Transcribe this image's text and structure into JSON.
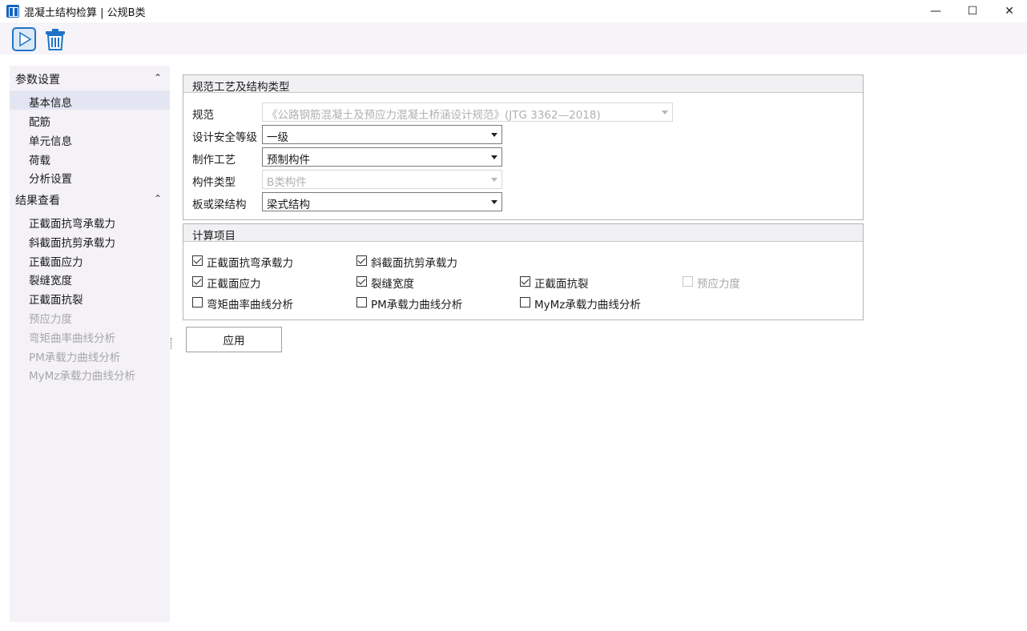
{
  "window": {
    "title": "混凝土结构检算 | 公规B类",
    "minimize": "—",
    "maximize": "☐",
    "close": "✕"
  },
  "toolbar": {
    "run_icon": "play-icon",
    "delete_icon": "trash-icon"
  },
  "sidebar": {
    "sections": [
      {
        "title": "参数设置",
        "items": [
          "基本信息",
          "配筋",
          "单元信息",
          "荷载",
          "分析设置"
        ]
      },
      {
        "title": "结果查看",
        "items": [
          "正截面抗弯承载力",
          "斜截面抗剪承载力",
          "正截面应力",
          "裂缝宽度",
          "正截面抗裂",
          "预应力度",
          "弯矩曲率曲线分析",
          "PM承载力曲线分析",
          "MyMz承载力曲线分析"
        ]
      }
    ],
    "selected": "基本信息",
    "disabled_items": [
      "预应力度",
      "弯矩曲率曲线分析",
      "PM承载力曲线分析",
      "MyMz承载力曲线分析"
    ],
    "collapse_glyph": "⌃"
  },
  "spec_group": {
    "title": "规范工艺及结构类型",
    "fields": [
      {
        "label": "规范",
        "value": "《公路钢筋混凝土及预应力混凝土桥涵设计规范》(JTG 3362—2018)",
        "enabled": false
      },
      {
        "label": "设计安全等级",
        "value": "一级",
        "enabled": true
      },
      {
        "label": "制作工艺",
        "value": "预制构件",
        "enabled": true
      },
      {
        "label": "构件类型",
        "value": "B类构件",
        "enabled": false
      },
      {
        "label": "板或梁结构",
        "value": "梁式结构",
        "enabled": true
      }
    ]
  },
  "calc_group": {
    "title": "计算项目",
    "checkboxes": [
      {
        "label": "正截面抗弯承载力",
        "checked": true,
        "enabled": true
      },
      {
        "label": "斜截面抗剪承载力",
        "checked": true,
        "enabled": true
      },
      {
        "label": "正截面应力",
        "checked": true,
        "enabled": true
      },
      {
        "label": "裂缝宽度",
        "checked": true,
        "enabled": true
      },
      {
        "label": "正截面抗裂",
        "checked": true,
        "enabled": true
      },
      {
        "label": "预应力度",
        "checked": false,
        "enabled": false
      },
      {
        "label": "弯矩曲率曲线分析",
        "checked": false,
        "enabled": true
      },
      {
        "label": "PM承载力曲线分析",
        "checked": false,
        "enabled": true
      },
      {
        "label": "MyMz承载力曲线分析",
        "checked": false,
        "enabled": true
      }
    ]
  },
  "apply_label": "应用",
  "colors": {
    "accent": "#1565c0",
    "sidebar_bg": "#f4f2f7",
    "selected_bg": "#e3e6f2",
    "disabled_text": "#a7a7a7"
  }
}
